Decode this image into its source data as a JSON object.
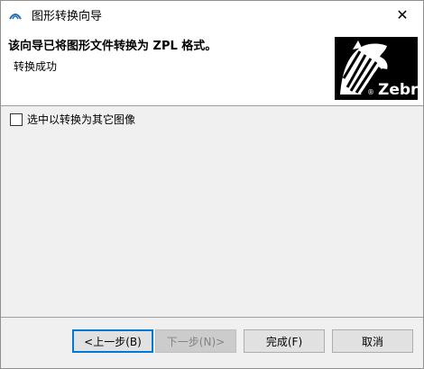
{
  "window": {
    "title": "图形转换向导",
    "close_glyph": "✕"
  },
  "header": {
    "title": "该向导已将图形文件转换为 ZPL 格式。",
    "subtitle": "转换成功",
    "logo_text": "Zebra",
    "logo_mark": "®"
  },
  "options": {
    "convert_other_label": "选中以转换为其它图像",
    "convert_other_checked": false
  },
  "buttons": {
    "back": "<上一步(B)",
    "next": "下一步(N)>",
    "finish": "完成(F)",
    "cancel": "取消"
  },
  "colors": {
    "accent": "#0078d7",
    "panel": "#f0f0f0",
    "header_bg": "#ffffff"
  }
}
